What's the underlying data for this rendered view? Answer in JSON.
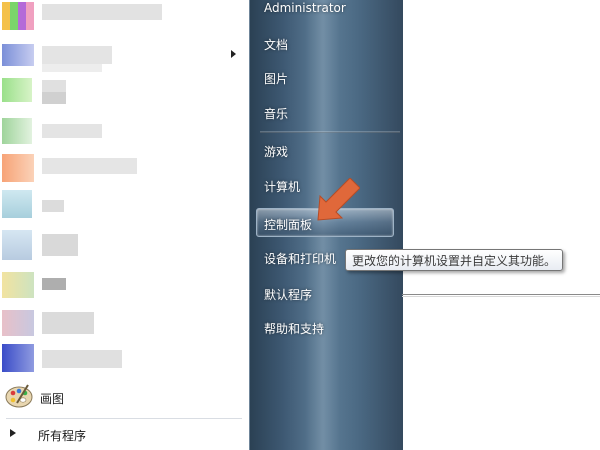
{
  "start_menu": {
    "left_panel": {
      "programs": [
        {
          "label": "",
          "icon": "blurred-app-icon"
        },
        {
          "label": "",
          "icon": "blurred-app-icon",
          "has_submenu": true
        },
        {
          "label": "",
          "icon": "blurred-app-icon"
        },
        {
          "label": "",
          "icon": "blurred-app-icon"
        },
        {
          "label": "",
          "icon": "blurred-app-icon"
        },
        {
          "label": "",
          "icon": "blurred-app-icon"
        },
        {
          "label": "",
          "icon": "blurred-app-icon"
        },
        {
          "label": "",
          "icon": "blurred-app-icon"
        },
        {
          "label": "",
          "icon": "blurred-app-icon"
        },
        {
          "label": "",
          "icon": "blurred-app-icon"
        },
        {
          "label": "画图",
          "icon": "paint-palette-icon"
        }
      ],
      "all_programs_label": "所有程序"
    },
    "right_panel": {
      "user": "Administrator",
      "items": [
        "文档",
        "图片",
        "音乐",
        "游戏",
        "计算机",
        "控制面板",
        "设备和打印机",
        "默认程序",
        "帮助和支持"
      ],
      "highlighted": "控制面板"
    },
    "tooltip": "更改您的计算机设置并自定义其功能。",
    "colors": {
      "panel_dark": "#2b4154",
      "panel_light": "#5f7f99",
      "arrow": "#e0683a"
    }
  }
}
